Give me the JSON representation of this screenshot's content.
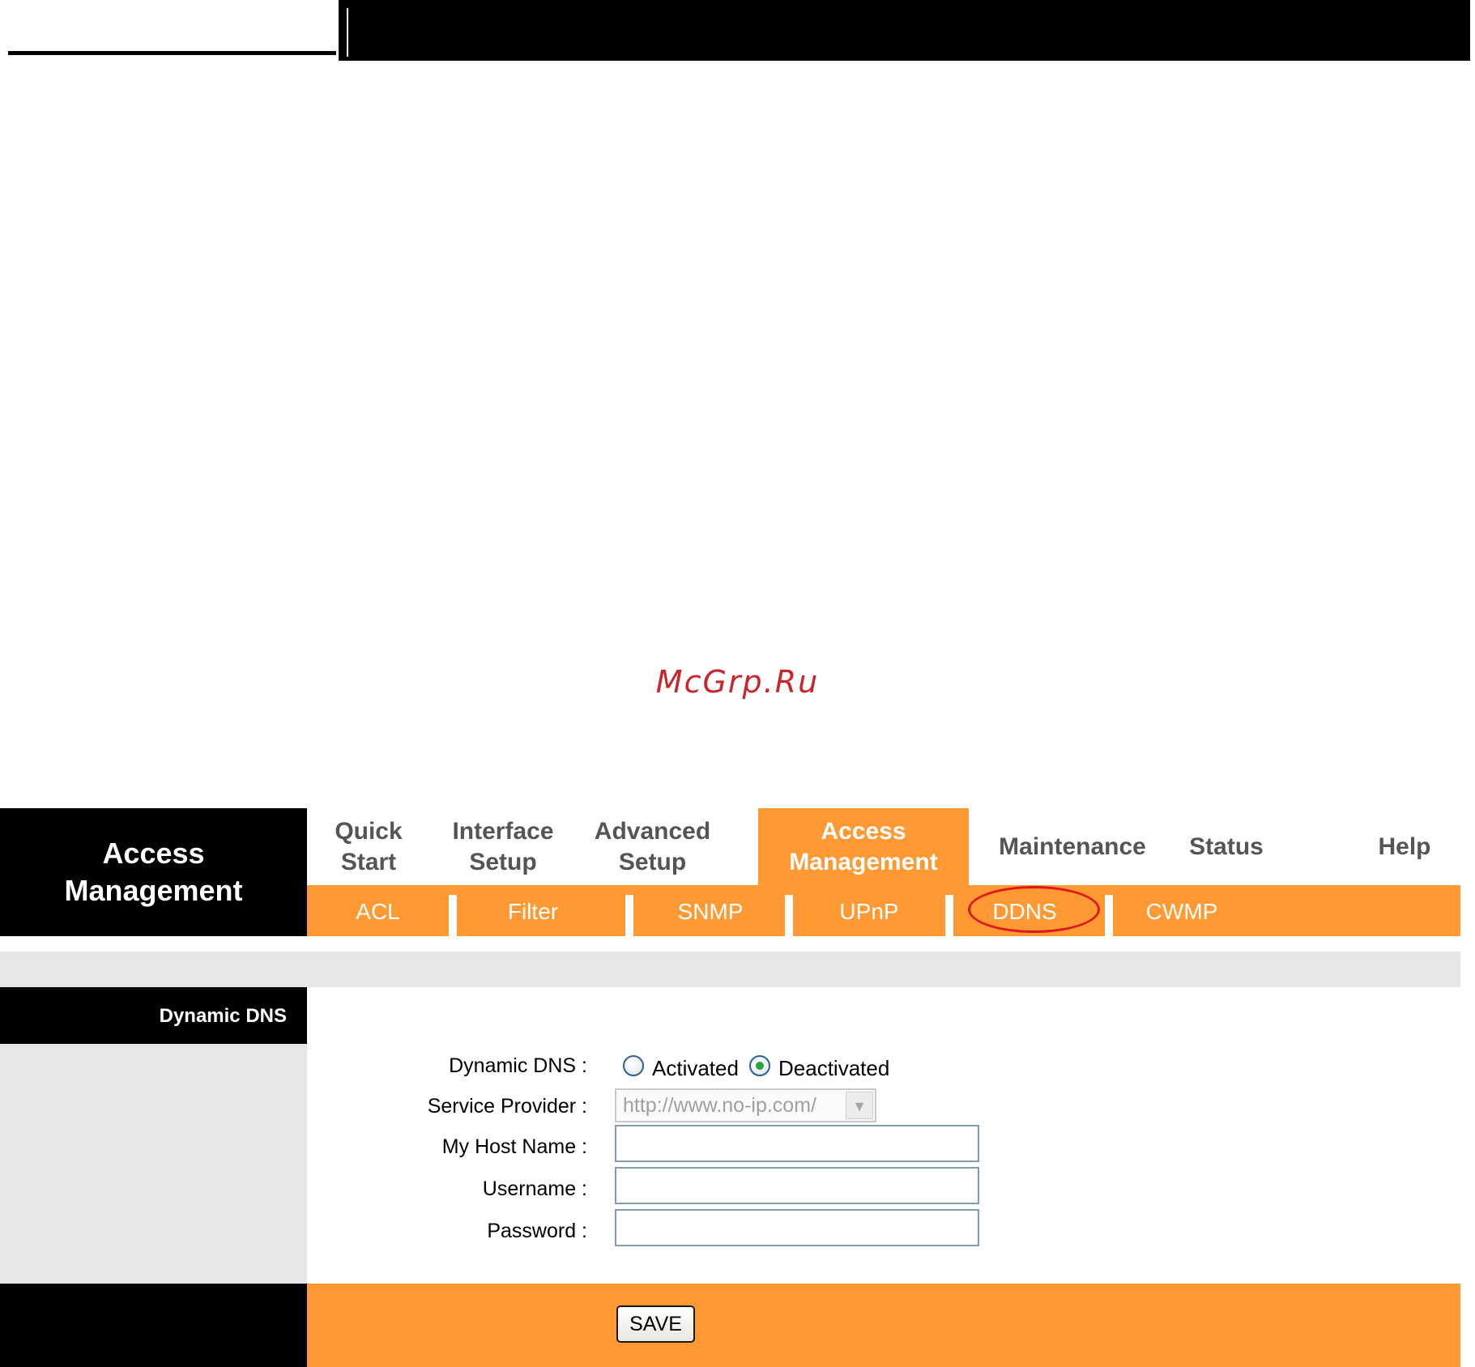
{
  "watermark": "McGrp.Ru",
  "brand": {
    "line1": "Access",
    "line2": "Management"
  },
  "menu": [
    {
      "line1": "Quick",
      "line2": "Start"
    },
    {
      "line1": "Interface",
      "line2": "Setup"
    },
    {
      "line1": "Advanced",
      "line2": "Setup"
    },
    {
      "line1": "Access",
      "line2": "Management",
      "active": true
    },
    {
      "line1": "Maintenance",
      "line2": ""
    },
    {
      "line1": "Status",
      "line2": ""
    },
    {
      "line1": "Help",
      "line2": ""
    }
  ],
  "submenu": [
    "ACL",
    "Filter",
    "SNMP",
    "UPnP",
    "DDNS",
    "CWMP"
  ],
  "section_title": "Dynamic DNS",
  "form": {
    "dynamic_dns_label": "Dynamic DNS :",
    "activated_label": "Activated",
    "deactivated_label": "Deactivated",
    "selected": "Deactivated",
    "service_provider_label": "Service Provider :",
    "service_provider_value": "http://www.no-ip.com/",
    "host_name_label": "My Host Name :",
    "host_name_value": "",
    "username_label": "Username :",
    "username_value": "",
    "password_label": "Password :",
    "password_value": ""
  },
  "save_label": "SAVE",
  "colors": {
    "accent": "#ff9933",
    "highlight_ring": "#e0181e"
  }
}
